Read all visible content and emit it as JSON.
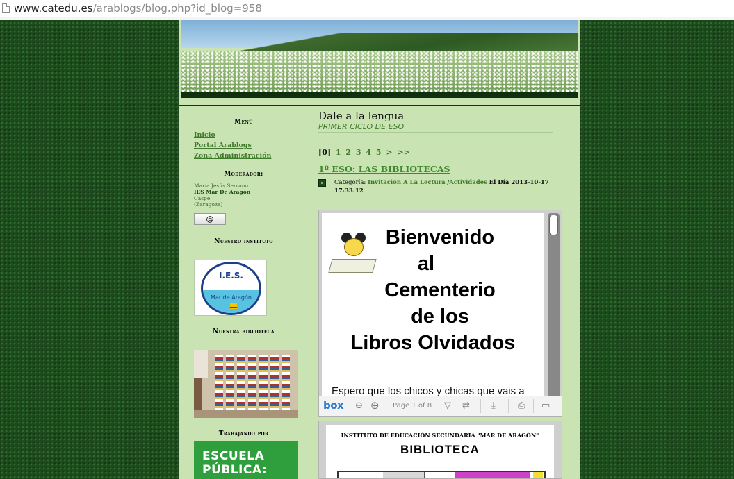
{
  "browser": {
    "url_host": "www.catedu.es",
    "url_path": "/arablogs/blog.php?id_blog=958"
  },
  "sidebar": {
    "menu_title": "Menú",
    "menu_links": [
      "Inicio",
      "Portal Arablogs",
      "Zona Administración"
    ],
    "moderator_title": "Moderador:",
    "moderator_name": "María Jesús Serrano",
    "moderator_school": "IES Mar De Aragón",
    "moderator_city": "Caspe",
    "moderator_province": "(Zaragoza)",
    "mail_button": "@",
    "institute_title": "Nuestro instituto",
    "ies_logo_line1": "I.E.S.",
    "ies_logo_line2": "Mar de Aragón",
    "library_title": "Nuestra biblioteca",
    "working_title": "Trabajando por",
    "working_banner": "ESCUELA PÚBLICA:"
  },
  "main": {
    "blog_title": "Dale a la lengua",
    "blog_subtitle": "PRIMER CICLO DE ESO",
    "pager_current": "[0]",
    "pager_links": [
      "1",
      "2",
      "3",
      "4",
      "5",
      ">",
      ">>"
    ],
    "post_title": "1º ESO: LAS BIBLIOTECAS",
    "meta_label": "Categoría:",
    "meta_cat1": "Invitación A La Lectura",
    "meta_sep": "/",
    "meta_cat2": "Actividades",
    "meta_date_prefix": "El Día 2013-10-17",
    "meta_time": "17:33:12"
  },
  "embed": {
    "slide_text_1": "Bienvenido",
    "slide_text_2": "al",
    "slide_text_3": "Cementerio",
    "slide_text_4": "de los",
    "slide_text_5": "Libros Olvidados",
    "paragraph": "Espero que los chicos y chicas que vais a",
    "toolbar_logo": "box",
    "page_label": "Page 1 of 8",
    "zoom_out_icon": "zoom-out-icon",
    "zoom_in_icon": "zoom-in-icon"
  },
  "doc2": {
    "header": "INSTITUTO DE EDUCACIÓN SECUNDARIA \"MAR DE ARAGÓN\"",
    "title": "BIBLIOTECA"
  }
}
